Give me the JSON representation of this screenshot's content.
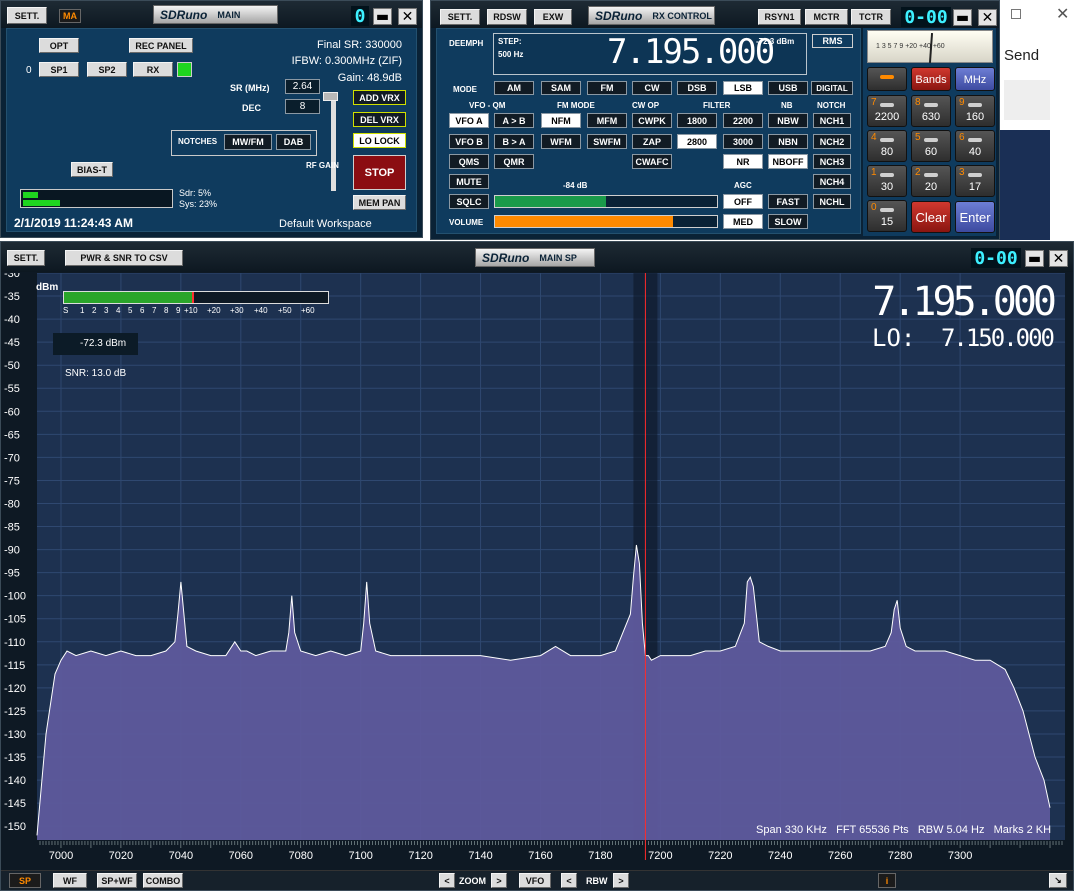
{
  "colors": {
    "accent": "#ff8a00",
    "stop": "#8b0d12",
    "led": "#1fd51f",
    "trace": "#ffffff",
    "marker": "#ff2a2a",
    "lcd": "#3df0ff"
  },
  "background": {
    "send_label": "Send"
  },
  "main_window": {
    "sett": "SETT.",
    "ma": "MA",
    "logo": "SDRuno",
    "title": "MAIN",
    "digit": "0",
    "opt": "OPT",
    "rec_panel": "REC PANEL",
    "zero": "0",
    "sp1": "SP1",
    "sp2": "SP2",
    "rx": "RX",
    "final_sr": "Final SR: 330000",
    "ifbw": "IFBW: 0.300MHz (ZIF)",
    "gain": "Gain: 48.9dB",
    "sr_label": "SR (MHz)",
    "sr_value": "2.64",
    "dec_label": "DEC",
    "dec_value": "8",
    "add_vrx": "ADD VRX",
    "del_vrx": "DEL VRX",
    "lo_lock": "LO LOCK",
    "notches": "NOTCHES",
    "mwfm": "MW/FM",
    "dab": "DAB",
    "rf_gain": "RF GAIN",
    "stop": "STOP",
    "bias_t": "BIAS-T",
    "sdr": "Sdr: 5%",
    "sys": "Sys: 23%",
    "sdr_load": 0.05,
    "sys_load": 0.23,
    "datetime": "2/1/2019 11:24:43 AM",
    "workspace": "Default Workspace",
    "mem_pan": "MEM PAN"
  },
  "rx_control": {
    "sett": "SETT.",
    "rdsw": "RDSW",
    "exw": "EXW",
    "logo": "SDRuno",
    "title": "RX CONTROL",
    "rsyn1": "RSYN1",
    "mctr": "MCTR",
    "tctr": "TCTR",
    "counter": "0-00",
    "deemph": "DEEMPH",
    "step_label": "STEP:",
    "step_value": "500 Hz",
    "frequency": "7.195.000",
    "dbm": "-72.3 dBm",
    "rms": "RMS",
    "mode_label": "MODE",
    "modes": [
      "AM",
      "SAM",
      "FM",
      "CW",
      "DSB",
      "LSB",
      "USB"
    ],
    "digital": "DIGITAL",
    "vfo_qm": "VFO - QM",
    "fm_mode": "FM MODE",
    "cw_op": "CW OP",
    "filter": "FILTER",
    "nb": "NB",
    "notch": "NOTCH",
    "vfo_a": "VFO A",
    "a_to_b": "A > B",
    "nfm": "NFM",
    "mfm": "MFM",
    "cwpk": "CWPK",
    "f1800": "1800",
    "f2200": "2200",
    "nbw": "NBW",
    "nch1": "NCH1",
    "vfo_b": "VFO B",
    "b_to_a": "B > A",
    "wfm": "WFM",
    "swfm": "SWFM",
    "zap": "ZAP",
    "f2800": "2800",
    "f3000": "3000",
    "nbn": "NBN",
    "nch2": "NCH2",
    "qms": "QMS",
    "qmr": "QMR",
    "cwafc": "CWAFC",
    "nr": "NR",
    "nboff": "NBOFF",
    "nch3": "NCH3",
    "mute": "MUTE",
    "sq_db": "-84 dB",
    "agc": "AGC",
    "nch4": "NCH4",
    "sqlc": "SQLC",
    "off": "OFF",
    "fast": "FAST",
    "nchl": "NCHL",
    "sql_level": 0.5,
    "volume_label": "VOLUME",
    "med": "MED",
    "slow": "SLOW",
    "volume_level": 0.8,
    "meter_scale": "1 3 5 7 9 +20 +40 +60",
    "bands": "Bands",
    "mhz": "MHz",
    "clear": "Clear",
    "enter": "Enter",
    "keypad": [
      {
        "n": "7",
        "v": "2200"
      },
      {
        "n": "8",
        "v": "630"
      },
      {
        "n": "9",
        "v": "160"
      },
      {
        "n": "4",
        "v": "80"
      },
      {
        "n": "5",
        "v": "60"
      },
      {
        "n": "6",
        "v": "40"
      },
      {
        "n": "1",
        "v": "30"
      },
      {
        "n": "2",
        "v": "20"
      },
      {
        "n": "3",
        "v": "17"
      },
      {
        "n": "0",
        "v": "15"
      }
    ]
  },
  "main_sp": {
    "sett": "SETT.",
    "pwr_csv": "PWR & SNR TO CSV",
    "logo": "SDRuno",
    "title": "MAIN SP",
    "counter": "0-00",
    "dbm_unit": "dBm",
    "freq": "7.195.000",
    "lo_label": "LO:",
    "lo_freq": "7.150.000",
    "level": "-72.3 dBm",
    "snr": "SNR: 13.0 dB",
    "smeter_scale": [
      "S",
      "1",
      "2",
      "3",
      "4",
      "5",
      "6",
      "7",
      "8",
      "9",
      "+10",
      "+20",
      "+30",
      "+40",
      "+50",
      "+60"
    ],
    "smeter_level": 0.49,
    "status": "Span 330 KHz   FFT 65536 Pts   RBW 5.04 Hz   Marks 2 KH",
    "sp": "SP",
    "wf": "WF",
    "spwf": "SP+WF",
    "combo": "COMBO",
    "zoom": "ZOOM",
    "vfo": "VFO",
    "rbw": "RBW"
  },
  "chart_data": {
    "type": "line",
    "title": "",
    "xlabel": "",
    "ylabel": "dBm",
    "xlim": [
      6992,
      7335
    ],
    "ylim": [
      -153,
      -30
    ],
    "x_ticks": [
      7000,
      7020,
      7040,
      7060,
      7080,
      7100,
      7120,
      7140,
      7160,
      7180,
      7200,
      7220,
      7240,
      7260,
      7280,
      7300
    ],
    "y_ticks": [
      -30,
      -35,
      -40,
      -45,
      -50,
      -55,
      -60,
      -65,
      -70,
      -75,
      -80,
      -85,
      -90,
      -95,
      -100,
      -105,
      -110,
      -115,
      -120,
      -125,
      -130,
      -135,
      -140,
      -145,
      -150
    ],
    "marker_x": 7195,
    "series": [
      {
        "x": [
          6992,
          6995,
          6998,
          7000,
          7002,
          7005,
          7010,
          7015,
          7020,
          7025,
          7030,
          7035,
          7038,
          7039,
          7040,
          7041,
          7042,
          7045,
          7050,
          7055,
          7058,
          7060,
          7062,
          7065,
          7070,
          7075,
          7076,
          7077,
          7078,
          7080,
          7085,
          7090,
          7095,
          7100,
          7101,
          7102,
          7103,
          7105,
          7110,
          7120,
          7130,
          7140,
          7150,
          7160,
          7165,
          7170,
          7175,
          7180,
          7185,
          7190,
          7191,
          7192,
          7193,
          7194,
          7195,
          7196,
          7197,
          7200,
          7205,
          7210,
          7215,
          7220,
          7225,
          7228,
          7229,
          7230,
          7231,
          7232,
          7233,
          7236,
          7240,
          7245,
          7250,
          7260,
          7270,
          7275,
          7277,
          7278,
          7279,
          7280,
          7282,
          7285,
          7290,
          7295,
          7300,
          7305,
          7310,
          7315,
          7318,
          7321,
          7323,
          7325,
          7328,
          7330
        ],
        "y": [
          -152,
          -130,
          -117,
          -114,
          -112,
          -113,
          -112,
          -113,
          -112,
          -113,
          -113,
          -112,
          -110,
          -104,
          -97,
          -104,
          -111,
          -112,
          -113,
          -113,
          -110,
          -112,
          -112,
          -113,
          -112,
          -112,
          -108,
          -100,
          -108,
          -112,
          -113,
          -112,
          -113,
          -112,
          -106,
          -97,
          -106,
          -112,
          -113,
          -113,
          -113,
          -113,
          -114,
          -113,
          -111,
          -113,
          -113,
          -113,
          -112,
          -104,
          -96,
          -89,
          -93,
          -106,
          -113,
          -113,
          -114,
          -113,
          -113,
          -113,
          -112,
          -112,
          -111,
          -106,
          -97,
          -96,
          -98,
          -104,
          -110,
          -111,
          -112,
          -112,
          -112,
          -112,
          -112,
          -111,
          -108,
          -103,
          -101,
          -107,
          -111,
          -112,
          -112,
          -112,
          -113,
          -114,
          -114,
          -116,
          -120,
          -125,
          -130,
          -135,
          -140,
          -146
        ]
      }
    ]
  }
}
